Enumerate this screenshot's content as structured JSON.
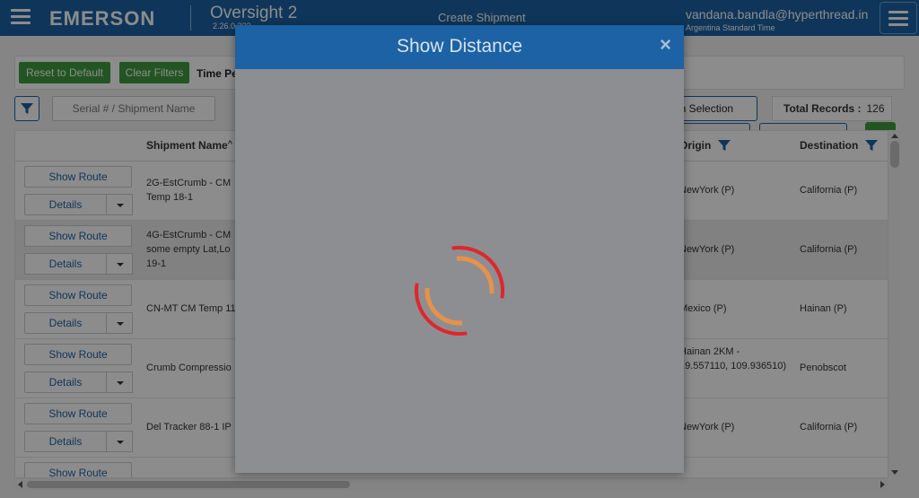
{
  "header": {
    "logo": "EMERSON",
    "app_name": "Oversight 2",
    "version": "2.26.0.???",
    "page_title": "Create Shipment",
    "user_email": "vandana.bandla@hyperthread.in",
    "timezone": "Argentina Standard Time"
  },
  "toolbar": {
    "reset_label": "Reset to Default",
    "clear_label": "Clear Filters",
    "time_period_label": "Time Pe",
    "search_placeholder": "Serial # / Shipment Name",
    "column_selection_label": "nn Selection",
    "total_records_label": "Total Records :",
    "total_records_count": "126"
  },
  "table": {
    "columns": {
      "shipment_name": "Shipment Name",
      "origin": "Origin",
      "destination": "Destination"
    },
    "rows": [
      {
        "route": "Show Route",
        "details": "Details",
        "name": "2G-EstCrumb - CM Temp 18-1",
        "origin": "NewYork (P)",
        "destination": "California (P)"
      },
      {
        "route": "Show Route",
        "details": "Details",
        "name": "4G-EstCrumb - CM some empty Lat,Lo 19-1",
        "origin": "NewYork (P)",
        "destination": "California (P)"
      },
      {
        "route": "Show Route",
        "details": "Details",
        "name": "CN-MT CM Temp 11",
        "origin": "Mexico (P)",
        "destination": "Hainan (P)"
      },
      {
        "route": "Show Route",
        "details": "Details",
        "name": "Crumb Compressio",
        "origin": "Hainan 2KM - 19.557110, 109.936510)",
        "destination": "Penobscot"
      },
      {
        "route": "Show Route",
        "details": "Details",
        "name": "Del Tracker 88-1 IP",
        "origin": "NewYork (P)",
        "destination": "California (P)"
      },
      {
        "route": "Show Route",
        "details": "",
        "name": "",
        "origin": "",
        "destination": ""
      }
    ]
  },
  "modal": {
    "title": "Show Distance",
    "close_symbol": "×"
  },
  "colors": {
    "header_blue": "#1d63a5",
    "button_green": "#3e9b3e",
    "spinner_red": "#e0262b",
    "spinner_orange": "#e8914a"
  }
}
